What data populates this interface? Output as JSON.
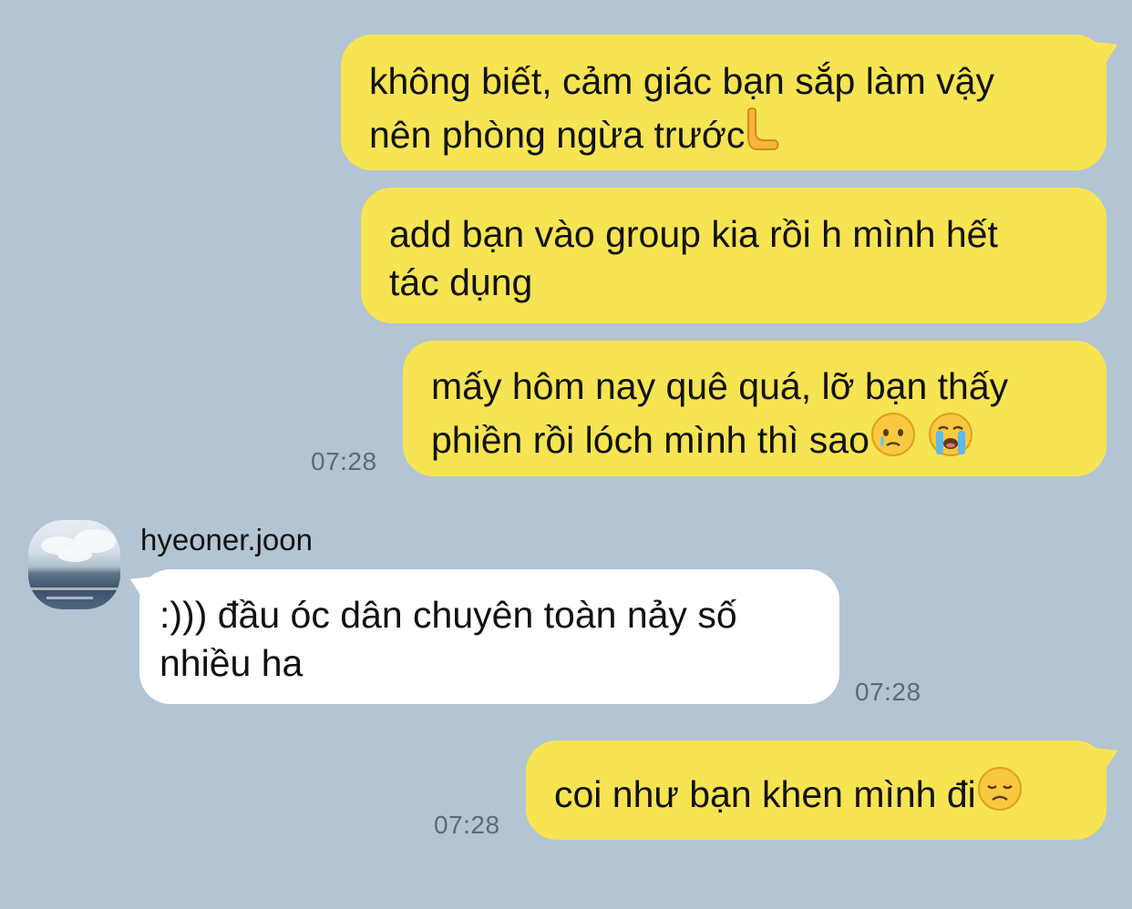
{
  "messages": [
    {
      "direction": "out",
      "text": "không biết, cảm giác bạn sắp làm vậy\nnên phòng ngừa trước",
      "emoji": "palm-down-hand-emoji"
    },
    {
      "direction": "out",
      "text": "add bạn vào group kia rồi h mình hết\ntác dụng"
    },
    {
      "direction": "out",
      "text": "mấy hôm nay quê quá, lỡ bạn thấy\nphiền rồi lóch mình thì sao",
      "emojis": [
        "face-holding-back-tears-emoji",
        "loudly-crying-face-emoji"
      ],
      "time": "07:28"
    },
    {
      "direction": "in",
      "sender": "hyeoner.joon",
      "text": ":))) đầu óc dân chuyên toàn nảy số\nnhiều ha",
      "time": "07:28"
    },
    {
      "direction": "out",
      "text": "coi như bạn khen mình đi",
      "emoji": "disappointed-face-emoji",
      "time": "07:28"
    }
  ],
  "colors": {
    "background": "#b3c5d3",
    "outgoing_bubble": "#f7e452",
    "incoming_bubble": "#ffffff",
    "timestamp": "#5c6a76",
    "text": "#111111"
  }
}
